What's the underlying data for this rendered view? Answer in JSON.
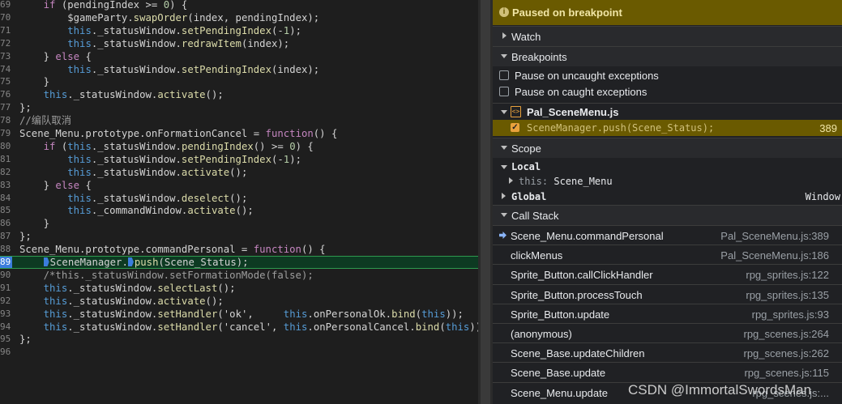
{
  "editor": {
    "lines": [
      {
        "n": "69",
        "t": "    if (pendingIndex >= 0) {"
      },
      {
        "n": "70",
        "t": "        $gameParty.swapOrder(index, pendingIndex);"
      },
      {
        "n": "71",
        "t": "        this._statusWindow.setPendingIndex(-1);"
      },
      {
        "n": "72",
        "t": "        this._statusWindow.redrawItem(index);"
      },
      {
        "n": "73",
        "t": "    } else {"
      },
      {
        "n": "74",
        "t": "        this._statusWindow.setPendingIndex(index);"
      },
      {
        "n": "75",
        "t": "    }"
      },
      {
        "n": "76",
        "t": "    this._statusWindow.activate();"
      },
      {
        "n": "77",
        "t": "};"
      },
      {
        "n": "78",
        "t": "//编队取消"
      },
      {
        "n": "79",
        "t": "Scene_Menu.prototype.onFormationCancel = function() {"
      },
      {
        "n": "80",
        "t": "    if (this._statusWindow.pendingIndex() >= 0) {"
      },
      {
        "n": "81",
        "t": "        this._statusWindow.setPendingIndex(-1);"
      },
      {
        "n": "82",
        "t": "        this._statusWindow.activate();"
      },
      {
        "n": "83",
        "t": "    } else {"
      },
      {
        "n": "84",
        "t": "        this._statusWindow.deselect();"
      },
      {
        "n": "85",
        "t": "        this._commandWindow.activate();"
      },
      {
        "n": "86",
        "t": "    }"
      },
      {
        "n": "87",
        "t": "};"
      },
      {
        "n": "88",
        "t": "Scene_Menu.prototype.commandPersonal = function() {"
      },
      {
        "n": "89",
        "t": "    SceneManager.push(Scene_Status);"
      },
      {
        "n": "90",
        "t": "    /*this._statusWindow.setFormationMode(false);"
      },
      {
        "n": "91",
        "t": "    this._statusWindow.selectLast();"
      },
      {
        "n": "92",
        "t": "    this._statusWindow.activate();"
      },
      {
        "n": "93",
        "t": "    this._statusWindow.setHandler('ok',     this.onPersonalOk.bind(this));"
      },
      {
        "n": "94",
        "t": "    this._statusWindow.setHandler('cancel', this.onPersonalCancel.bind(this));"
      },
      {
        "n": "95",
        "t": "};"
      },
      {
        "n": "96",
        "t": ""
      }
    ]
  },
  "debugger": {
    "banner": "Paused on breakpoint",
    "info_glyph": "i",
    "watch": "Watch",
    "breakpoints": "Breakpoints",
    "pause_uncaught": "Pause on uncaught exceptions",
    "pause_caught": "Pause on caught exceptions",
    "file_glyph": "<>",
    "file_name": "Pal_SceneMenu.js",
    "check_glyph": "✓",
    "bp_code": "SceneManager.push(Scene_Status);",
    "bp_line": "389",
    "scope": "Scope",
    "local": "Local",
    "this_key": "this:",
    "this_value": "Scene_Menu",
    "global": "Global",
    "global_value": "Window",
    "call_stack": "Call Stack",
    "stack": [
      {
        "fn": "Scene_Menu.commandPersonal",
        "loc": "Pal_SceneMenu.js:389"
      },
      {
        "fn": "clickMenus",
        "loc": "Pal_SceneMenu.js:186"
      },
      {
        "fn": "Sprite_Button.callClickHandler",
        "loc": "rpg_sprites.js:122"
      },
      {
        "fn": "Sprite_Button.processTouch",
        "loc": "rpg_sprites.js:135"
      },
      {
        "fn": "Sprite_Button.update",
        "loc": "rpg_sprites.js:93"
      },
      {
        "fn": "(anonymous)",
        "loc": "rpg_scenes.js:264"
      },
      {
        "fn": "Scene_Base.updateChildren",
        "loc": "rpg_scenes.js:262"
      },
      {
        "fn": "Scene_Base.update",
        "loc": "rpg_scenes.js:115"
      },
      {
        "fn": "Scene_Menu.update",
        "loc": "rpg_scenes.js:..."
      }
    ]
  },
  "watermark": "CSDN @ImmortalSwordsMan"
}
